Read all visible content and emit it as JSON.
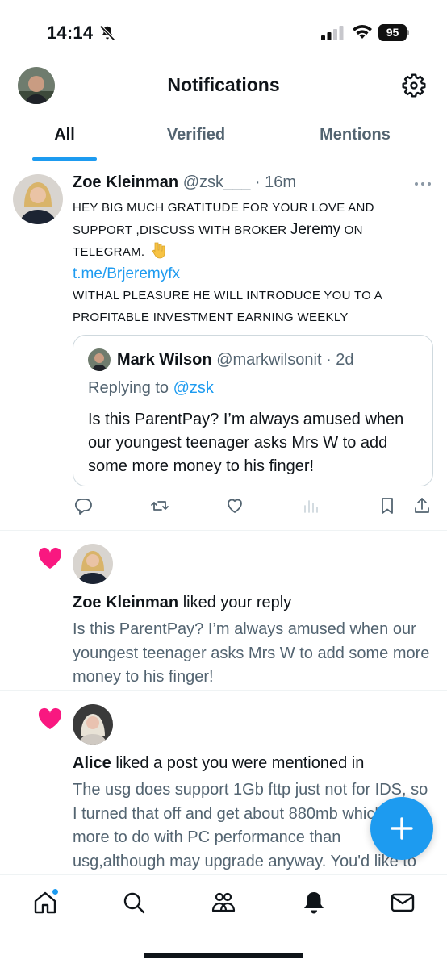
{
  "status_bar": {
    "time": "14:14",
    "battery": "95"
  },
  "header": {
    "title": "Notifications"
  },
  "tabs": [
    {
      "label": "All",
      "active": true
    },
    {
      "label": "Verified",
      "active": false
    },
    {
      "label": "Mentions",
      "active": false
    }
  ],
  "tweet": {
    "name": "Zoe Kleinman",
    "handle": "@zsk___",
    "time": "16m",
    "body": {
      "line1": "HEY BIG MUCH GRATITUDE FOR YOUR LOVE AND",
      "line2": "SUPPORT ,DISCUSS WITH BROKER ",
      "line2_name": "Jeremy",
      "line2_end": " ON",
      "line3": "TELEGRAM.",
      "link": "t.me/Brjeremyfx",
      "line5": "WITHAL PLEASURE HE WILL INTRODUCE YOU TO A",
      "line6": "PROFITABLE INVESTMENT EARNING WEEKLY"
    },
    "quote": {
      "name": "Mark Wilson",
      "handle": "@markwilsonit",
      "time": "2d",
      "replying_prefix": "Replying to ",
      "replying_to": "@zsk",
      "text": "Is this ParentPay? I’m always amused when our youngest teenager asks Mrs W to add some more money to his finger!"
    }
  },
  "notifications": [
    {
      "name": "Zoe Kleinman",
      "action": " liked your reply",
      "text": "Is this ParentPay? I’m always amused when our youngest teenager asks Mrs W to add some more money to his finger!"
    },
    {
      "name": "Alice",
      "action": " liked a post you were mentioned in",
      "text": "The usg does support 1Gb fttp just not for IDS, so I turned that off and get about 880mb which is more to do with PC performance than usg,although may upgrade anyway. You'd like to think a broadcast standard would get you..."
    }
  ],
  "colors": {
    "accent": "#1d9bf0",
    "like": "#f91880",
    "secondary_text": "#536471"
  },
  "icons": [
    "bell-off-icon",
    "signal-icon",
    "wifi-icon",
    "gear-icon",
    "more-icon",
    "reply-icon",
    "retweet-icon",
    "like-icon",
    "views-icon",
    "bookmark-icon",
    "share-icon",
    "heart-icon",
    "plus-icon",
    "home-icon",
    "search-icon",
    "community-icon",
    "bell-icon",
    "mail-icon"
  ]
}
